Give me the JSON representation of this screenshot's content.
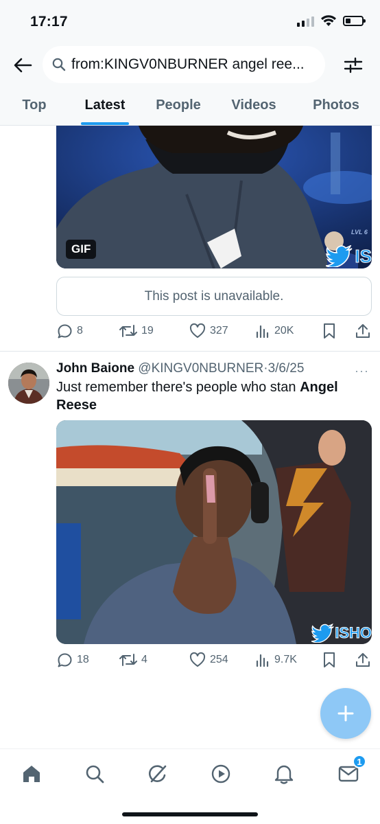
{
  "status_bar": {
    "time": "17:17"
  },
  "search": {
    "query": "from:KINGV0NBURNER angel ree..."
  },
  "tabs": [
    {
      "label": "Top"
    },
    {
      "label": "Latest"
    },
    {
      "label": "People"
    },
    {
      "label": "Videos"
    },
    {
      "label": "Photos"
    }
  ],
  "active_tab": "Latest",
  "post1": {
    "media_badge": "GIF",
    "watermark": "IS",
    "quote_notice": "This post is unavailable.",
    "stats": {
      "replies": "8",
      "reposts": "19",
      "likes": "327",
      "views": "20K"
    }
  },
  "post2": {
    "author_name": "John Baione",
    "handle": "@KINGV0NBURNER",
    "separator": "·",
    "date": "3/6/25",
    "more": "···",
    "text_plain": "Just remember there's people who stan ",
    "text_bold": "Angel Reese",
    "watermark": "ISHO",
    "stats": {
      "replies": "18",
      "reposts": "4",
      "likes": "254",
      "views": "9.7K"
    }
  },
  "bottom_nav": {
    "items": [
      "home-icon",
      "search-icon",
      "grok-icon",
      "video-icon",
      "notifications-icon",
      "messages-icon"
    ],
    "messages_badge": "1"
  },
  "colors": {
    "accent": "#1d9bf0",
    "fab": "#8ec8f6",
    "text_secondary": "#536471"
  }
}
